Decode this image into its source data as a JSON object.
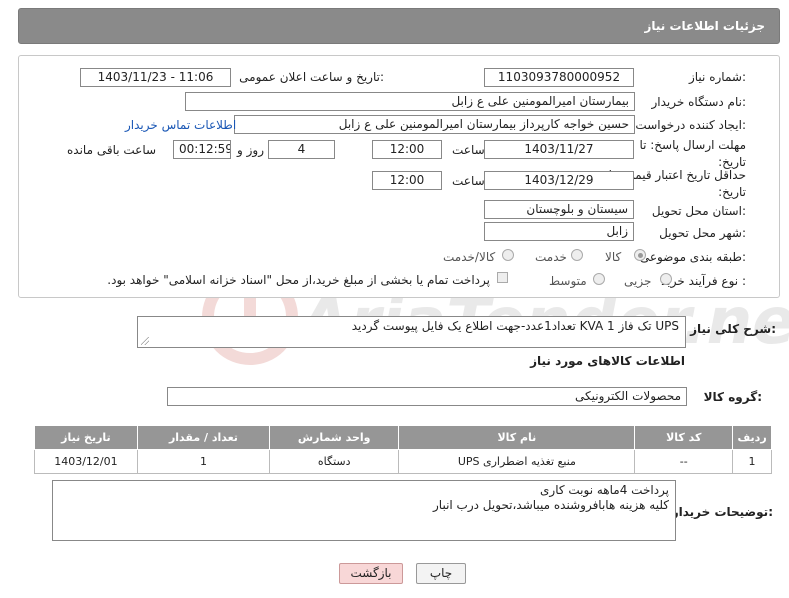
{
  "header": {
    "title": "جزئیات اطلاعات نیاز"
  },
  "form": {
    "need_number_label": "شماره نیاز:",
    "need_number": "1103093780000952",
    "announce_label": "تاریخ و ساعت اعلان عمومی:",
    "announce_value": "1403/11/23 - 11:06",
    "buyer_org_label": "نام دستگاه خریدار:",
    "buyer_org": "بیمارستان امیرالمومنین علی  ع  زابل",
    "creator_label": "ایجاد کننده درخواست:",
    "creator": "حسین خواجه کارپرداز بیمارستان امیرالمومنین علی  ع  زابل",
    "contact_link": "اطلاعات تماس خریدار",
    "deadline_label": "مهلت ارسال پاسخ: تا تاریخ:",
    "deadline_date": "1403/11/27",
    "time_label": "ساعت",
    "deadline_time": "12:00",
    "days_value": "4",
    "days_label": "روز و",
    "remaining_time": "00:12:59",
    "remaining_label": "ساعت باقی مانده",
    "validity_label": "حداقل تاریخ اعتبار قیمت: تا تاریخ:",
    "validity_date": "1403/12/29",
    "validity_time": "12:00",
    "province_label": "استان محل تحویل:",
    "province": "سیستان و بلوچستان",
    "city_label": "شهر محل تحویل:",
    "city": "زابل",
    "category_label": "طبقه بندی موضوعی:",
    "category_options": [
      "کالا",
      "خدمت",
      "کالا/خدمت"
    ],
    "process_label": "نوع فرآیند خرید :",
    "process_options": [
      "جزیی",
      "متوسط"
    ],
    "payment_note": "پرداخت تمام یا بخشی از مبلغ خرید،از محل \"اسناد خزانه اسلامی\" خواهد بود."
  },
  "description": {
    "label": "شرح کلی نیاز:",
    "text": "UPS  تک فاز KVA 1 تعداد1عدد-جهت اطلاع یک فایل پیوست گردید"
  },
  "goods_section_title": "اطلاعات کالاهای مورد نیاز",
  "goods_group": {
    "label": "گروه کالا:",
    "value": "محصولات الکترونیکی"
  },
  "table": {
    "headers": [
      "ردیف",
      "کد کالا",
      "نام کالا",
      "واحد شمارش",
      "تعداد / مقدار",
      "تاریخ نیاز"
    ],
    "rows": [
      [
        "1",
        "--",
        "منبع تغذیه اضطراری UPS",
        "دستگاه",
        "1",
        "1403/12/01"
      ]
    ]
  },
  "buyer_notes": {
    "label": "توضیحات خریدار:",
    "line1": "پرداخت 4ماهه نوبت کاری",
    "line2": "کلیه هزینه هابافروشنده میباشد،تحویل درب انبار"
  },
  "buttons": {
    "print": "چاپ",
    "back": "بازگشت"
  },
  "watermark": {
    "text": "AriaTender.neT"
  },
  "colors": {
    "header_bg": "#8a8a8a",
    "link": "#1a57b5",
    "back_button_bg": "#f8d7d7"
  }
}
